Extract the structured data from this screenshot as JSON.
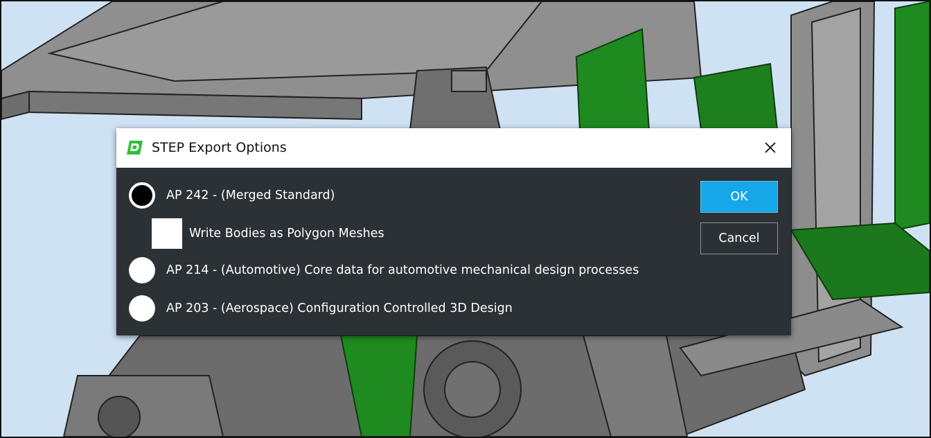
{
  "dialog": {
    "title": "STEP Export Options",
    "icon": "app-logo-icon",
    "close_icon": "close-icon",
    "options": [
      {
        "label": "AP 242 - (Merged Standard)",
        "selected": true
      },
      {
        "label": "AP 214 - (Automotive) Core data for automotive mechanical design processes",
        "selected": false
      },
      {
        "label": "AP 203 - (Aerospace) Configuration Controlled 3D Design",
        "selected": false
      }
    ],
    "checkbox": {
      "label": "Write Bodies as Polygon Meshes",
      "checked": false
    },
    "ok_label": "OK",
    "cancel_label": "Cancel"
  },
  "colors": {
    "dialog_bg": "#2c3136",
    "accent": "#16a7e8",
    "model_gray": "#8e8e8e",
    "model_green": "#1f8a1f",
    "viewport_bg": "#cfe2f4"
  }
}
